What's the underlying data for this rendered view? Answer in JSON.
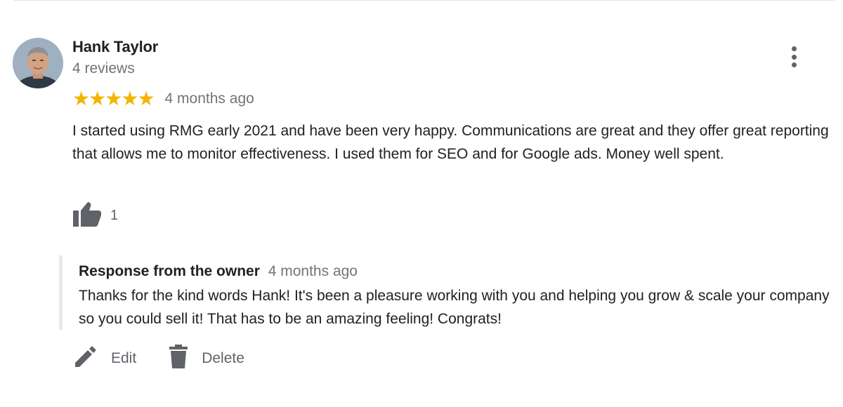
{
  "review": {
    "reviewer_name": "Hank Taylor",
    "review_count": "4 reviews",
    "rating": 5,
    "stars": [
      "★",
      "★",
      "★",
      "★",
      "★"
    ],
    "time": "4 months ago",
    "text": "I started using RMG early 2021 and have been very happy. Communications are great and they offer great reporting that allows me to monitor effectiveness. I used them for SEO and for Google ads. Money well spent.",
    "like_count": "1",
    "icons": {
      "avatar": "avatar",
      "more": "more-vert-icon",
      "like": "thumbs-up-icon"
    }
  },
  "owner_response": {
    "title": "Response from the owner",
    "time": "4 months ago",
    "text": "Thanks for the kind words Hank! It's been a pleasure working with you and helping you grow & scale your company so you could sell it! That has to be an amazing feeling! Congrats!"
  },
  "actions": {
    "edit_label": "Edit",
    "delete_label": "Delete",
    "edit_icon": "pencil-icon",
    "delete_icon": "trash-icon"
  },
  "colors": {
    "star": "#f4b400",
    "secondary_text": "#70757a",
    "icon_gray": "#5f6368",
    "primary_text": "#202124"
  }
}
